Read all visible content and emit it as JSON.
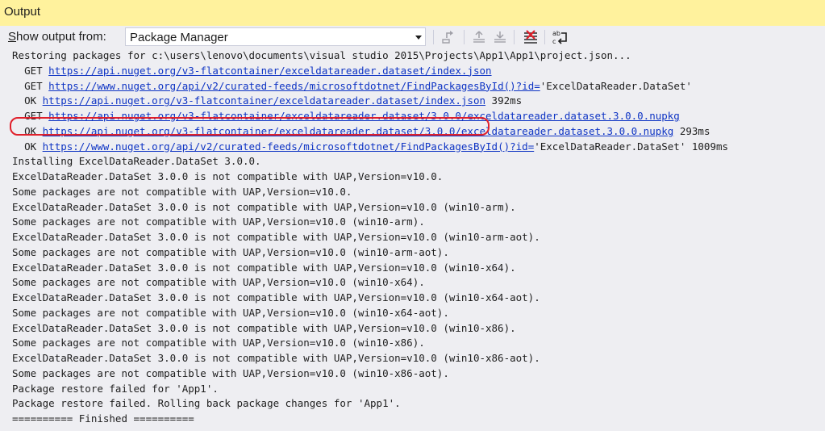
{
  "window": {
    "title": "Output"
  },
  "toolbar": {
    "show_output_label_pre": "S",
    "show_output_label_rest": "how output from:",
    "source_selected": "Package Manager",
    "buttons": [
      {
        "name": "find-message-in-code-icon"
      },
      {
        "name": "go-to-previous-message-icon"
      },
      {
        "name": "go-to-next-message-icon"
      },
      {
        "name": "clear-all-icon"
      },
      {
        "name": "toggle-word-wrap-icon"
      }
    ]
  },
  "output": {
    "lines": [
      {
        "type": "text",
        "text": "Restoring packages for c:\\users\\lenovo\\documents\\visual studio 2015\\Projects\\App1\\App1\\project.json..."
      },
      {
        "type": "link",
        "indent": "  ",
        "prefix": "GET ",
        "url": "https://api.nuget.org/v3-flatcontainer/exceldatareader.dataset/index.json",
        "suffix": ""
      },
      {
        "type": "link",
        "indent": "  ",
        "prefix": "GET ",
        "url": "https://www.nuget.org/api/v2/curated-feeds/microsoftdotnet/FindPackagesById()?id=",
        "suffix": "'ExcelDataReader.DataSet'"
      },
      {
        "type": "link",
        "indent": "  ",
        "prefix": "OK ",
        "url": "https://api.nuget.org/v3-flatcontainer/exceldatareader.dataset/index.json",
        "suffix": " 392ms"
      },
      {
        "type": "link",
        "indent": "  ",
        "prefix": "GET ",
        "url": "https://api.nuget.org/v3-flatcontainer/exceldatareader.dataset/3.0.0/exceldatareader.dataset.3.0.0.nupkg",
        "suffix": ""
      },
      {
        "type": "link",
        "indent": "  ",
        "prefix": "OK ",
        "url": "https://api.nuget.org/v3-flatcontainer/exceldatareader.dataset/3.0.0/exceldatareader.dataset.3.0.0.nupkg",
        "suffix": " 293ms"
      },
      {
        "type": "link",
        "indent": "  ",
        "prefix": "OK ",
        "url": "https://www.nuget.org/api/v2/curated-feeds/microsoftdotnet/FindPackagesById()?id=",
        "suffix": "'ExcelDataReader.DataSet' 1009ms"
      },
      {
        "type": "text",
        "text": "Installing ExcelDataReader.DataSet 3.0.0."
      },
      {
        "type": "text",
        "text": "ExcelDataReader.DataSet 3.0.0 is not compatible with UAP,Version=v10.0.",
        "highlighted": true
      },
      {
        "type": "text",
        "text": "Some packages are not compatible with UAP,Version=v10.0."
      },
      {
        "type": "text",
        "text": "ExcelDataReader.DataSet 3.0.0 is not compatible with UAP,Version=v10.0 (win10-arm)."
      },
      {
        "type": "text",
        "text": "Some packages are not compatible with UAP,Version=v10.0 (win10-arm)."
      },
      {
        "type": "text",
        "text": "ExcelDataReader.DataSet 3.0.0 is not compatible with UAP,Version=v10.0 (win10-arm-aot)."
      },
      {
        "type": "text",
        "text": "Some packages are not compatible with UAP,Version=v10.0 (win10-arm-aot)."
      },
      {
        "type": "text",
        "text": "ExcelDataReader.DataSet 3.0.0 is not compatible with UAP,Version=v10.0 (win10-x64)."
      },
      {
        "type": "text",
        "text": "Some packages are not compatible with UAP,Version=v10.0 (win10-x64)."
      },
      {
        "type": "text",
        "text": "ExcelDataReader.DataSet 3.0.0 is not compatible with UAP,Version=v10.0 (win10-x64-aot)."
      },
      {
        "type": "text",
        "text": "Some packages are not compatible with UAP,Version=v10.0 (win10-x64-aot)."
      },
      {
        "type": "text",
        "text": "ExcelDataReader.DataSet 3.0.0 is not compatible with UAP,Version=v10.0 (win10-x86)."
      },
      {
        "type": "text",
        "text": "Some packages are not compatible with UAP,Version=v10.0 (win10-x86)."
      },
      {
        "type": "text",
        "text": "ExcelDataReader.DataSet 3.0.0 is not compatible with UAP,Version=v10.0 (win10-x86-aot)."
      },
      {
        "type": "text",
        "text": "Some packages are not compatible with UAP,Version=v10.0 (win10-x86-aot)."
      },
      {
        "type": "text",
        "text": "Package restore failed for 'App1'."
      },
      {
        "type": "text",
        "text": "Package restore failed. Rolling back package changes for 'App1'."
      },
      {
        "type": "text",
        "text": "========== Finished =========="
      }
    ]
  },
  "colors": {
    "titlebar_bg": "#fff29d",
    "link": "#0e34c4",
    "highlight_border": "#e0202b",
    "background": "#eeeef2"
  }
}
